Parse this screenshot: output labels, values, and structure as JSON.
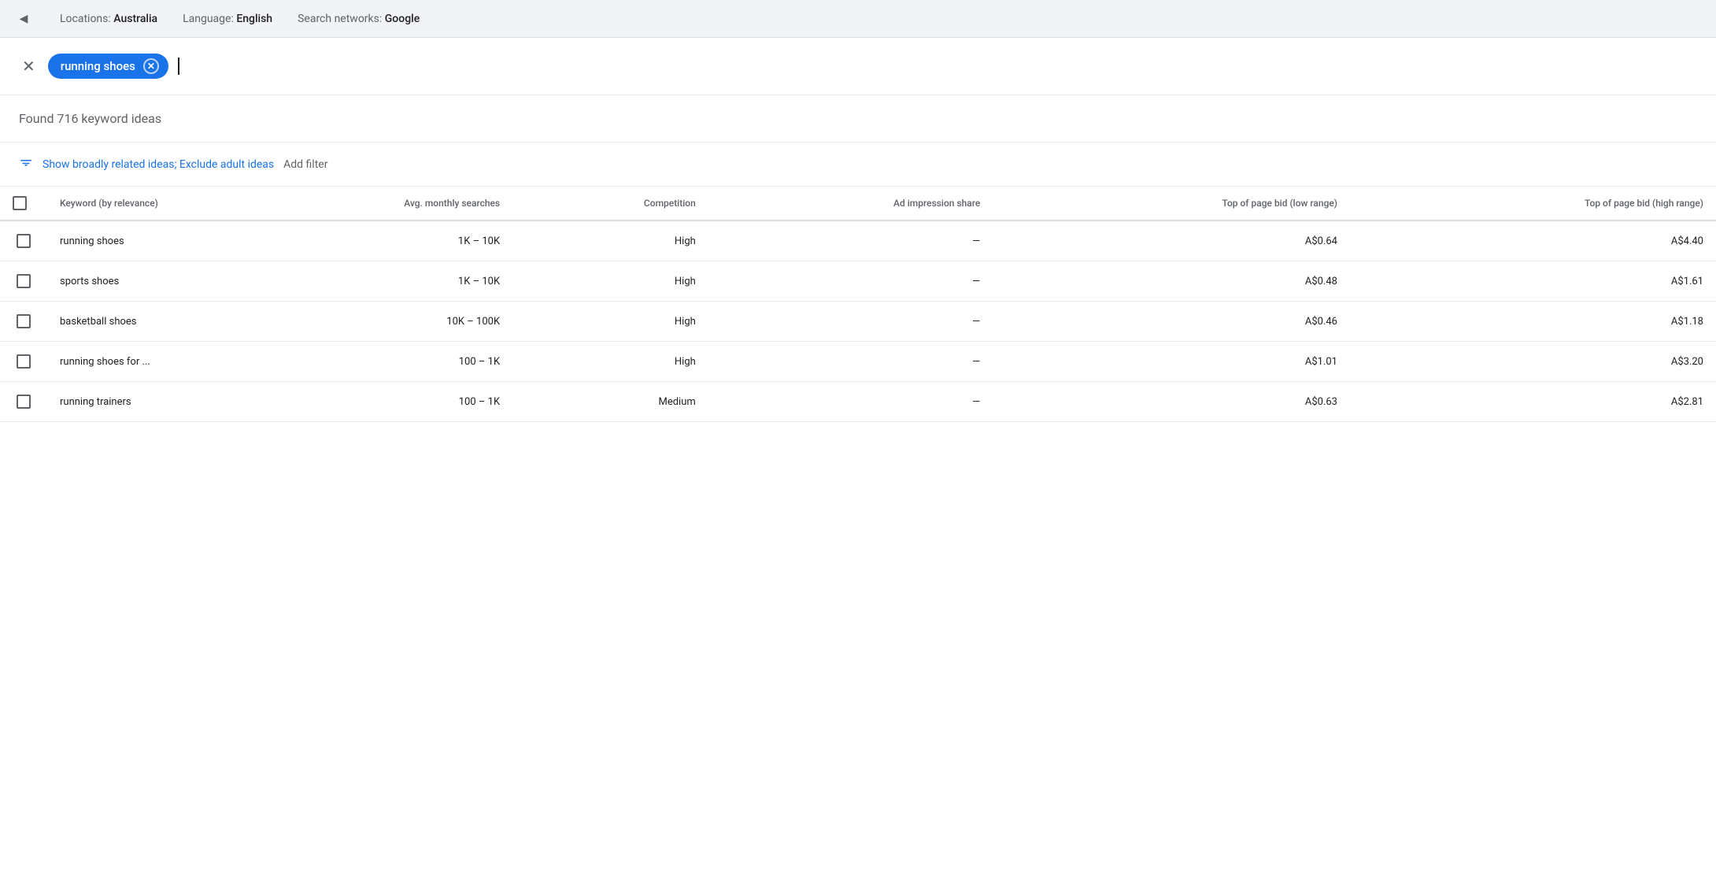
{
  "topBar": {
    "toggleLabel": "◀",
    "location": {
      "label": "Locations:",
      "value": "Australia"
    },
    "language": {
      "label": "Language:",
      "value": "English"
    },
    "network": {
      "label": "Search networks:",
      "value": "Google"
    }
  },
  "searchArea": {
    "closeLabel": "✕",
    "keyword": "running shoes",
    "chipCloseLabel": "✕"
  },
  "foundBar": {
    "text": "Found 716 keyword ideas"
  },
  "filterBar": {
    "filterText": "Show broadly related ideas; Exclude adult ideas",
    "addFilterText": "Add filter"
  },
  "table": {
    "headers": [
      {
        "id": "checkbox",
        "label": ""
      },
      {
        "id": "keyword",
        "label": "Keyword (by relevance)"
      },
      {
        "id": "avg-monthly",
        "label": "Avg. monthly searches"
      },
      {
        "id": "competition",
        "label": "Competition"
      },
      {
        "id": "ad-impression",
        "label": "Ad impression share"
      },
      {
        "id": "top-bid-low",
        "label": "Top of page bid (low range)"
      },
      {
        "id": "top-bid-high",
        "label": "Top of page bid (high range)"
      }
    ],
    "rows": [
      {
        "keyword": "running shoes",
        "avgMonthly": "1K – 10K",
        "competition": "High",
        "adImpression": "—",
        "topBidLow": "A$0.64",
        "topBidHigh": "A$4.40"
      },
      {
        "keyword": "sports shoes",
        "avgMonthly": "1K – 10K",
        "competition": "High",
        "adImpression": "—",
        "topBidLow": "A$0.48",
        "topBidHigh": "A$1.61"
      },
      {
        "keyword": "basketball shoes",
        "avgMonthly": "10K – 100K",
        "competition": "High",
        "adImpression": "—",
        "topBidLow": "A$0.46",
        "topBidHigh": "A$1.18"
      },
      {
        "keyword": "running shoes for ...",
        "avgMonthly": "100 – 1K",
        "competition": "High",
        "adImpression": "—",
        "topBidLow": "A$1.01",
        "topBidHigh": "A$3.20"
      },
      {
        "keyword": "running trainers",
        "avgMonthly": "100 – 1K",
        "competition": "Medium",
        "adImpression": "—",
        "topBidLow": "A$0.63",
        "topBidHigh": "A$2.81"
      }
    ]
  },
  "colors": {
    "blue": "#1a73e8",
    "lightGray": "#f1f3f4",
    "borderGray": "#dadce0",
    "textGray": "#5f6368"
  }
}
